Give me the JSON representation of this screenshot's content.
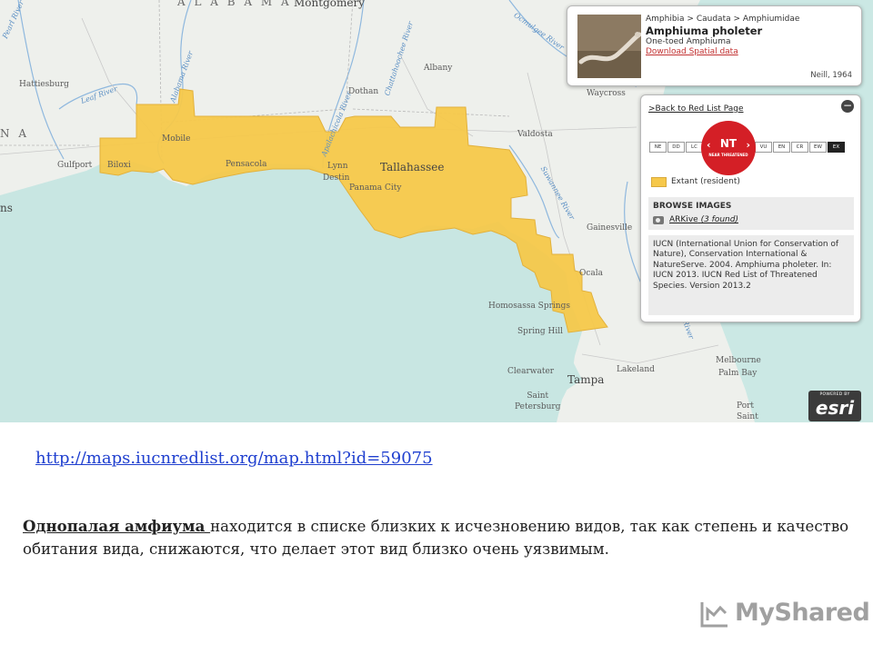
{
  "map": {
    "state_labels": {
      "alabama": "A L A B A M A",
      "louisiana": "N A"
    },
    "cities": {
      "montgomery": "Montgomery",
      "hattiesburg": "Hattiesburg",
      "albany": "Albany",
      "dothan": "Dothan",
      "waycross": "Waycross",
      "valdosta": "Valdosta",
      "mobile": "Mobile",
      "gulfport": "Gulfport",
      "biloxi": "Biloxi",
      "pensacola": "Pensacola",
      "tallahassee": "Tallahassee",
      "lynn": "Lynn",
      "destin": "Destin",
      "panama_city": "Panama City",
      "gainesville": "Gainesville",
      "ocala": "Ocala",
      "homosassa_springs": "Homosassa Springs",
      "spring_hill": "Spring Hill",
      "clearwater": "Clearwater",
      "tampa": "Tampa",
      "lakeland": "Lakeland",
      "saint_petersburg": "Saint\nPetersburg",
      "melbourne": "Melbourne",
      "palm_bay": "Palm Bay",
      "port_saint": "Port\nSaint",
      "new_orleans_fragment": "ns"
    },
    "rivers": {
      "pearl": "Pearl River",
      "leaf": "Leaf River",
      "alabama": "Alabama River",
      "chattahoochee": "Chattahoochee River",
      "apalachicola": "Apalachicola River",
      "ocmulgee": "Ocmulgee River",
      "suwannee": "Suwannee River",
      "st_johns": "St. Johns River"
    },
    "colors": {
      "range": "#f6c84a",
      "range_stroke": "#e2b13c",
      "water": "#c8e6e2",
      "land": "#eef0ec",
      "river": "#8fb8de"
    }
  },
  "species_card": {
    "taxonomy": "Amphibia > Caudata > Amphiumidae",
    "scientific_name": "Amphiuma pholeter",
    "common_name": "One-toed Amphiuma",
    "download_link": "Download Spatial data",
    "photo_credit": "Neill, 1964"
  },
  "status_card": {
    "back_link": ">Back to Red List Page",
    "close_icon": "minus-icon",
    "categories": [
      "NE",
      "DD",
      "LC",
      "NT",
      "VU",
      "EN",
      "CR",
      "EW",
      "EX"
    ],
    "current_status": {
      "code": "NT",
      "label": "NEAR THREATENED",
      "color": "#d41f26"
    },
    "legend_label": "Extant (resident)",
    "browse_title": "BROWSE IMAGES",
    "arkive_link": "ARKive",
    "arkive_count": "(3 found)",
    "citation": "IUCN (International Union for Conservation of Nature), Conservation International & NatureServe. 2004. Amphiuma pholeter. In: IUCN 2013. IUCN Red List of Threatened Species. Version 2013.2"
  },
  "esri_logo": {
    "powered": "POWERED BY",
    "word": "esri"
  },
  "slide": {
    "source_link": "http://maps.iucnredlist.org/map.html?id=59075",
    "species_ru": "Однопалая амфиума ",
    "description": "находится в списке близких к исчезновению видов, так как степень и качество обитания вида, снижаются, что делает этот вид близко очень уязвимым.",
    "watermark": "MyShared"
  }
}
